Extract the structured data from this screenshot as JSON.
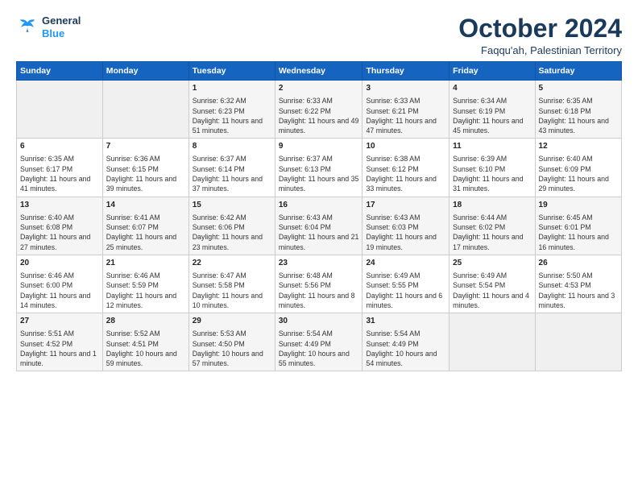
{
  "logo": {
    "line1": "General",
    "line2": "Blue"
  },
  "title": "October 2024",
  "location": "Faqqu'ah, Palestinian Territory",
  "days_header": [
    "Sunday",
    "Monday",
    "Tuesday",
    "Wednesday",
    "Thursday",
    "Friday",
    "Saturday"
  ],
  "weeks": [
    [
      {
        "day": "",
        "info": ""
      },
      {
        "day": "",
        "info": ""
      },
      {
        "day": "1",
        "info": "Sunrise: 6:32 AM\nSunset: 6:23 PM\nDaylight: 11 hours and 51 minutes."
      },
      {
        "day": "2",
        "info": "Sunrise: 6:33 AM\nSunset: 6:22 PM\nDaylight: 11 hours and 49 minutes."
      },
      {
        "day": "3",
        "info": "Sunrise: 6:33 AM\nSunset: 6:21 PM\nDaylight: 11 hours and 47 minutes."
      },
      {
        "day": "4",
        "info": "Sunrise: 6:34 AM\nSunset: 6:19 PM\nDaylight: 11 hours and 45 minutes."
      },
      {
        "day": "5",
        "info": "Sunrise: 6:35 AM\nSunset: 6:18 PM\nDaylight: 11 hours and 43 minutes."
      }
    ],
    [
      {
        "day": "6",
        "info": "Sunrise: 6:35 AM\nSunset: 6:17 PM\nDaylight: 11 hours and 41 minutes."
      },
      {
        "day": "7",
        "info": "Sunrise: 6:36 AM\nSunset: 6:15 PM\nDaylight: 11 hours and 39 minutes."
      },
      {
        "day": "8",
        "info": "Sunrise: 6:37 AM\nSunset: 6:14 PM\nDaylight: 11 hours and 37 minutes."
      },
      {
        "day": "9",
        "info": "Sunrise: 6:37 AM\nSunset: 6:13 PM\nDaylight: 11 hours and 35 minutes."
      },
      {
        "day": "10",
        "info": "Sunrise: 6:38 AM\nSunset: 6:12 PM\nDaylight: 11 hours and 33 minutes."
      },
      {
        "day": "11",
        "info": "Sunrise: 6:39 AM\nSunset: 6:10 PM\nDaylight: 11 hours and 31 minutes."
      },
      {
        "day": "12",
        "info": "Sunrise: 6:40 AM\nSunset: 6:09 PM\nDaylight: 11 hours and 29 minutes."
      }
    ],
    [
      {
        "day": "13",
        "info": "Sunrise: 6:40 AM\nSunset: 6:08 PM\nDaylight: 11 hours and 27 minutes."
      },
      {
        "day": "14",
        "info": "Sunrise: 6:41 AM\nSunset: 6:07 PM\nDaylight: 11 hours and 25 minutes."
      },
      {
        "day": "15",
        "info": "Sunrise: 6:42 AM\nSunset: 6:06 PM\nDaylight: 11 hours and 23 minutes."
      },
      {
        "day": "16",
        "info": "Sunrise: 6:43 AM\nSunset: 6:04 PM\nDaylight: 11 hours and 21 minutes."
      },
      {
        "day": "17",
        "info": "Sunrise: 6:43 AM\nSunset: 6:03 PM\nDaylight: 11 hours and 19 minutes."
      },
      {
        "day": "18",
        "info": "Sunrise: 6:44 AM\nSunset: 6:02 PM\nDaylight: 11 hours and 17 minutes."
      },
      {
        "day": "19",
        "info": "Sunrise: 6:45 AM\nSunset: 6:01 PM\nDaylight: 11 hours and 16 minutes."
      }
    ],
    [
      {
        "day": "20",
        "info": "Sunrise: 6:46 AM\nSunset: 6:00 PM\nDaylight: 11 hours and 14 minutes."
      },
      {
        "day": "21",
        "info": "Sunrise: 6:46 AM\nSunset: 5:59 PM\nDaylight: 11 hours and 12 minutes."
      },
      {
        "day": "22",
        "info": "Sunrise: 6:47 AM\nSunset: 5:58 PM\nDaylight: 11 hours and 10 minutes."
      },
      {
        "day": "23",
        "info": "Sunrise: 6:48 AM\nSunset: 5:56 PM\nDaylight: 11 hours and 8 minutes."
      },
      {
        "day": "24",
        "info": "Sunrise: 6:49 AM\nSunset: 5:55 PM\nDaylight: 11 hours and 6 minutes."
      },
      {
        "day": "25",
        "info": "Sunrise: 6:49 AM\nSunset: 5:54 PM\nDaylight: 11 hours and 4 minutes."
      },
      {
        "day": "26",
        "info": "Sunrise: 5:50 AM\nSunset: 4:53 PM\nDaylight: 11 hours and 3 minutes."
      }
    ],
    [
      {
        "day": "27",
        "info": "Sunrise: 5:51 AM\nSunset: 4:52 PM\nDaylight: 11 hours and 1 minute."
      },
      {
        "day": "28",
        "info": "Sunrise: 5:52 AM\nSunset: 4:51 PM\nDaylight: 10 hours and 59 minutes."
      },
      {
        "day": "29",
        "info": "Sunrise: 5:53 AM\nSunset: 4:50 PM\nDaylight: 10 hours and 57 minutes."
      },
      {
        "day": "30",
        "info": "Sunrise: 5:54 AM\nSunset: 4:49 PM\nDaylight: 10 hours and 55 minutes."
      },
      {
        "day": "31",
        "info": "Sunrise: 5:54 AM\nSunset: 4:49 PM\nDaylight: 10 hours and 54 minutes."
      },
      {
        "day": "",
        "info": ""
      },
      {
        "day": "",
        "info": ""
      }
    ]
  ]
}
